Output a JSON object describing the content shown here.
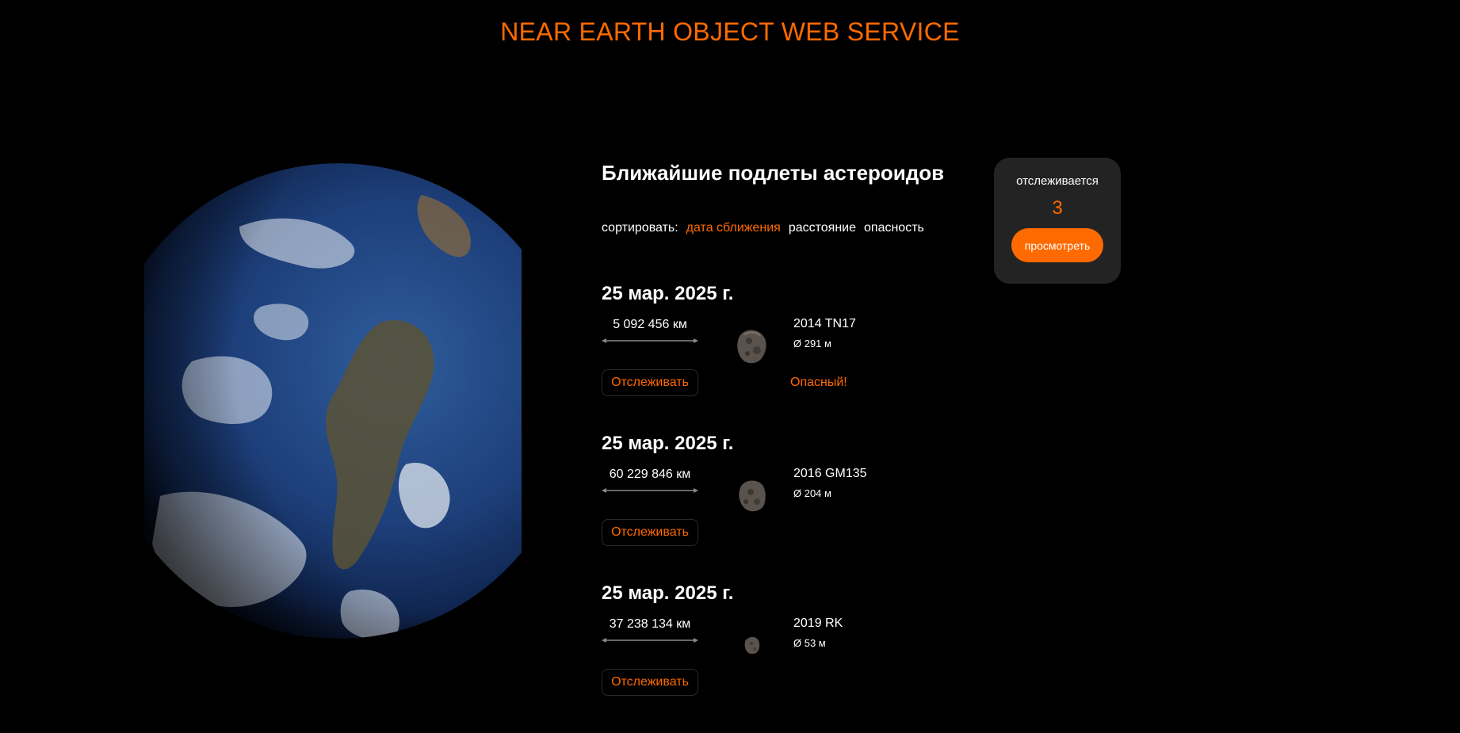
{
  "header": {
    "title": "NEAR EARTH OBJECT WEB SERVICE"
  },
  "main": {
    "title": "Ближайшие подлеты астероидов",
    "sort": {
      "label": "сортировать:",
      "options": [
        "дата сближения",
        "расстояние",
        "опасность"
      ],
      "active": "дата сближения"
    },
    "approaches": [
      {
        "date": "25 мар. 2025 г.",
        "distance": "5 092 456 км",
        "name": "2014 TN17",
        "diameter": "Ø 291 м",
        "track_label": "Отслеживать",
        "hazard": "Опасный!",
        "icon": "asteroid-icon"
      },
      {
        "date": "25 мар. 2025 г.",
        "distance": "60 229 846 км",
        "name": "2016 GM135",
        "diameter": "Ø 204 м",
        "track_label": "Отслеживать",
        "hazard": "",
        "icon": "asteroid-icon"
      },
      {
        "date": "25 мар. 2025 г.",
        "distance": "37 238 134 км",
        "name": "2019 RK",
        "diameter": "Ø 53 м",
        "track_label": "Отслеживать",
        "hazard": "",
        "icon": "asteroid-icon"
      }
    ]
  },
  "tracker": {
    "label": "отслеживается",
    "count": "3",
    "button_label": "просмотреть"
  },
  "colors": {
    "accent": "#ff6a00",
    "background": "#000000",
    "card": "#232323"
  }
}
